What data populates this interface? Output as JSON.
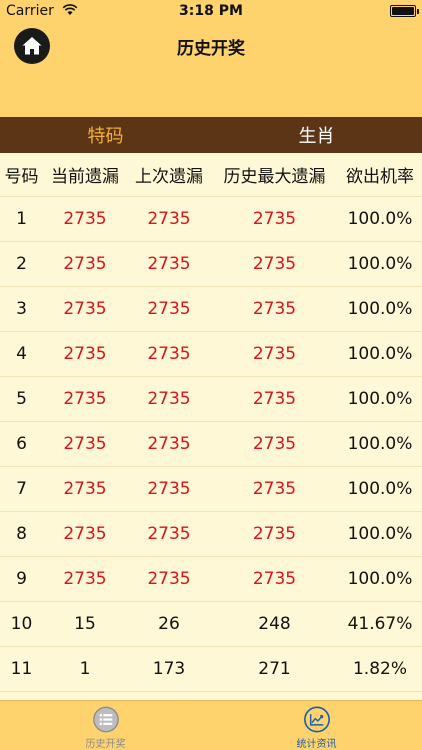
{
  "status_bar": {
    "carrier": "Carrier",
    "time": "3:18 PM"
  },
  "nav": {
    "title": "历史开奖",
    "home_icon": "home-icon"
  },
  "tabs": [
    {
      "label": "特码",
      "active": true
    },
    {
      "label": "生肖",
      "active": false
    }
  ],
  "table": {
    "headers": [
      "号码",
      "当前遗漏",
      "上次遗漏",
      "历史最大遗漏",
      "欲出机率"
    ],
    "rows": [
      {
        "num": "1",
        "current": "2735",
        "last": "2735",
        "max": "2735",
        "rate": "100.0%"
      },
      {
        "num": "2",
        "current": "2735",
        "last": "2735",
        "max": "2735",
        "rate": "100.0%"
      },
      {
        "num": "3",
        "current": "2735",
        "last": "2735",
        "max": "2735",
        "rate": "100.0%"
      },
      {
        "num": "4",
        "current": "2735",
        "last": "2735",
        "max": "2735",
        "rate": "100.0%"
      },
      {
        "num": "5",
        "current": "2735",
        "last": "2735",
        "max": "2735",
        "rate": "100.0%"
      },
      {
        "num": "6",
        "current": "2735",
        "last": "2735",
        "max": "2735",
        "rate": "100.0%"
      },
      {
        "num": "7",
        "current": "2735",
        "last": "2735",
        "max": "2735",
        "rate": "100.0%"
      },
      {
        "num": "8",
        "current": "2735",
        "last": "2735",
        "max": "2735",
        "rate": "100.0%"
      },
      {
        "num": "9",
        "current": "2735",
        "last": "2735",
        "max": "2735",
        "rate": "100.0%"
      },
      {
        "num": "10",
        "current": "15",
        "last": "26",
        "max": "248",
        "rate": "41.67%"
      },
      {
        "num": "11",
        "current": "1",
        "last": "173",
        "max": "271",
        "rate": "1.82%"
      }
    ]
  },
  "bottom_tabs": [
    {
      "label": "历史开奖",
      "icon": "list-icon",
      "active": false
    },
    {
      "label": "统计资讯",
      "icon": "chart-icon",
      "active": true
    }
  ],
  "colors": {
    "header_bg": "#fed26c",
    "tab_bar_bg": "#5c3416",
    "active_tab": "#f6b332",
    "table_bg": "#fff8d6",
    "missing_red": "#d8141c",
    "active_bottom": "#1e5ea8"
  }
}
